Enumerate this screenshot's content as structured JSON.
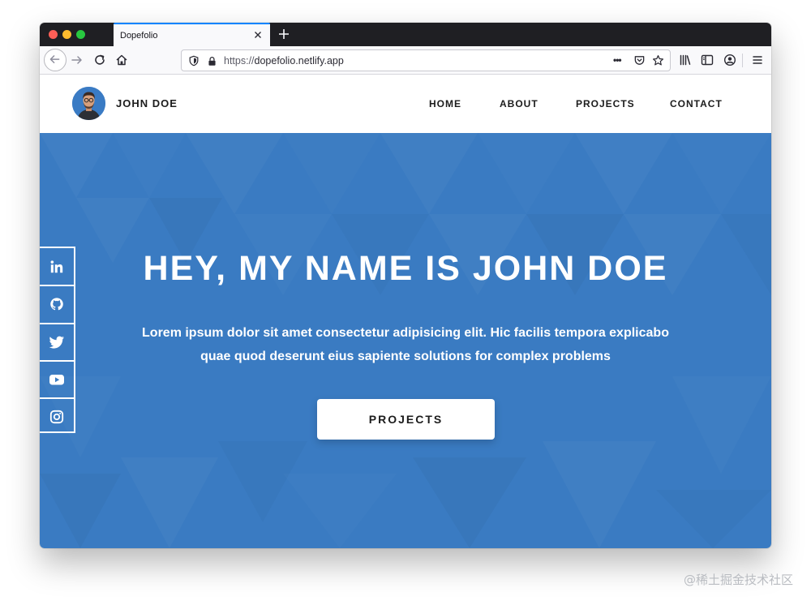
{
  "browser": {
    "tab_title": "Dopefolio",
    "url_protocol": "https://",
    "url_host": "dopefolio.netlify.app",
    "page_actions_glyph": "•••"
  },
  "site": {
    "brand": "JOHN DOE",
    "nav": [
      "HOME",
      "ABOUT",
      "PROJECTS",
      "CONTACT"
    ],
    "hero_title": "HEY, MY NAME IS JOHN DOE",
    "hero_subtitle_line1": "Lorem ipsum dolor sit amet consectetur adipisicing elit. Hic facilis tempora explicabo",
    "hero_subtitle_line2": "quae quod deserunt eius sapiente solutions for complex problems",
    "cta_label": "PROJECTS",
    "social": [
      "linkedin-icon",
      "github-icon",
      "twitter-icon",
      "youtube-icon",
      "instagram-icon"
    ]
  },
  "watermark": "@稀土掘金技术社区",
  "colors": {
    "hero_blue": "#3a7bc2",
    "tab_accent": "#0a84ff",
    "text_dark": "#1c1c1c"
  }
}
